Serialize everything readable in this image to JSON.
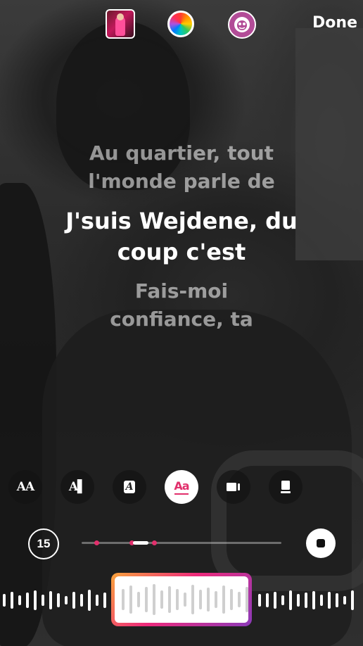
{
  "top_bar": {
    "done_label": "Done",
    "icons": [
      "album-cover-thumbnail",
      "color-wheel-icon",
      "effect-face-icon"
    ]
  },
  "lyrics": {
    "previous": [
      "Au quartier, tout",
      "l'monde parle de"
    ],
    "current": [
      "J'suis Wejdene, du",
      "coup c'est"
    ],
    "next": [
      "Fais-moi",
      "confiance, ta"
    ]
  },
  "style_buttons": [
    {
      "label": "AA",
      "name": "style-typewriter"
    },
    {
      "label": "A▌",
      "name": "style-cursor"
    },
    {
      "label": "A",
      "name": "style-boxed"
    },
    {
      "label": "Aa",
      "name": "style-underline",
      "selected": true
    },
    {
      "label": "",
      "name": "style-card"
    },
    {
      "label": "",
      "name": "style-cube"
    }
  ],
  "timeline": {
    "duration_label": "15",
    "progress": 0.3
  },
  "colors": {
    "accent": "#e1306c",
    "gradient": [
      "#f9a53b",
      "#ee2a7b",
      "#8a3ab9"
    ]
  }
}
